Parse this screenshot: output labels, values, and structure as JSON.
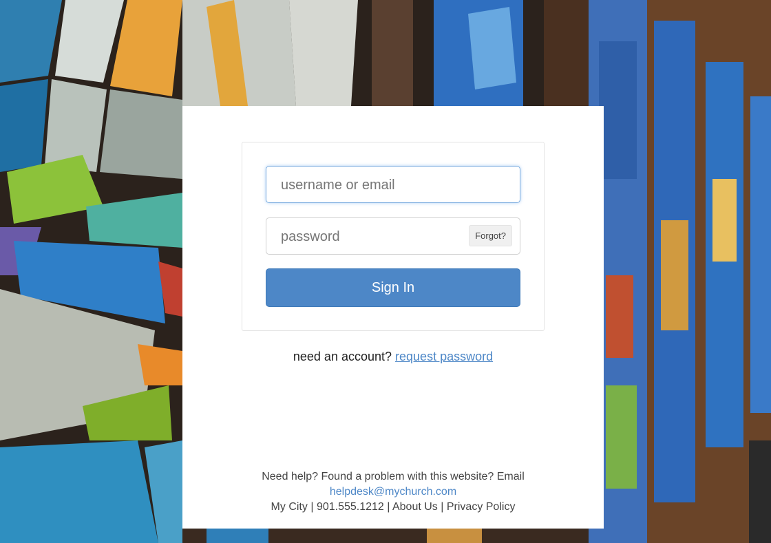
{
  "login": {
    "username_placeholder": "username or email",
    "password_placeholder": "password",
    "forgot_label": "Forgot?",
    "signin_label": "Sign In"
  },
  "account": {
    "prompt": "need an account?",
    "request_link": "request password"
  },
  "footer": {
    "help_text": "Need help? Found a problem with this website? Email",
    "email": "helpdesk@mychurch.com",
    "city": "My City",
    "sep": "|",
    "phone": "901.555.1212",
    "about": "About Us",
    "privacy": "Privacy Policy"
  },
  "colors": {
    "accent": "#4d87c7",
    "focus_border": "#7eaee0"
  }
}
